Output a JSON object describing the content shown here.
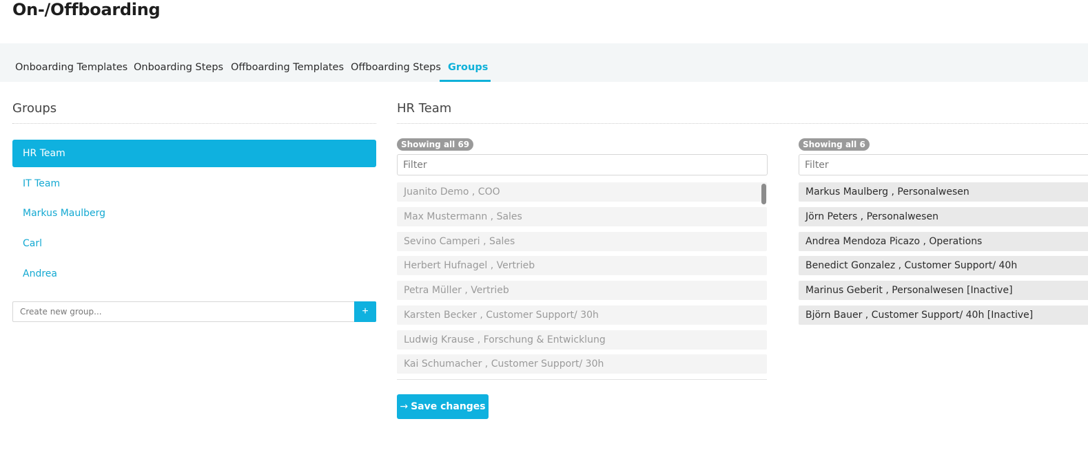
{
  "page": {
    "title": "On-/Offboarding"
  },
  "tabs": [
    {
      "label": "Onboarding Templates",
      "active": false
    },
    {
      "label": "Onboarding Steps",
      "active": false
    },
    {
      "label": "Offboarding Templates",
      "active": false
    },
    {
      "label": "Offboarding Steps",
      "active": false
    },
    {
      "label": "Groups",
      "active": true
    }
  ],
  "groups_panel": {
    "title": "Groups",
    "items": [
      {
        "label": "HR Team",
        "selected": true
      },
      {
        "label": "IT Team",
        "selected": false
      },
      {
        "label": "Markus Maulberg",
        "selected": false
      },
      {
        "label": "Carl",
        "selected": false
      },
      {
        "label": "Andrea",
        "selected": false
      }
    ],
    "new_group_placeholder": "Create new group...",
    "add_label": "+"
  },
  "detail": {
    "title": "HR Team",
    "available": {
      "badge": "Showing all 69",
      "filter_placeholder": "Filter",
      "items": [
        "Juanito Demo , COO",
        "Max Mustermann , Sales",
        "Sevino Camperi , Sales",
        "Herbert Hufnagel , Vertrieb",
        "Petra Müller , Vertrieb",
        "Karsten Becker , Customer Support/ 30h",
        "Ludwig Krause , Forschung & Entwicklung",
        "Kai Schumacher , Customer Support/ 30h"
      ]
    },
    "selected": {
      "badge": "Showing all 6",
      "filter_placeholder": "Filter",
      "items": [
        "Markus Maulberg , Personalwesen",
        "Jörn Peters , Personalwesen",
        "Andrea Mendoza Picazo , Operations",
        "Benedict Gonzalez , Customer Support/ 40h",
        "Marinus Geberit , Personalwesen [Inactive]",
        "Björn Bauer , Customer Support/ 40h [Inactive]"
      ]
    },
    "save_label": "Save changes",
    "save_icon": "arrow-right-icon"
  },
  "colors": {
    "accent": "#0fb1df",
    "tabbar_bg": "#f3f6f7",
    "badge_bg": "#9a9a9a"
  }
}
